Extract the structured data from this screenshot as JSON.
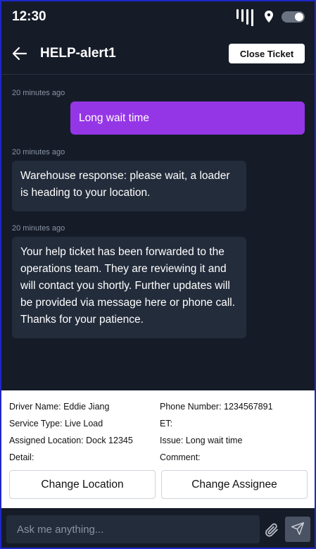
{
  "status_bar": {
    "time": "12:30"
  },
  "header": {
    "title": "HELP-alert1",
    "close_ticket_label": "Close Ticket"
  },
  "messages": [
    {
      "timestamp": "20 minutes ago",
      "direction": "outgoing",
      "text": "Long wait time"
    },
    {
      "timestamp": "20 minutes ago",
      "direction": "incoming",
      "text": "Warehouse response: please wait, a loader is heading to your location."
    },
    {
      "timestamp": "20 minutes ago",
      "direction": "incoming",
      "text": "Your help ticket has been forwarded to the operations team. They are reviewing it and will contact you shortly. Further updates will be provided via message here or phone call. Thanks for your patience."
    }
  ],
  "ticket_info": {
    "driver_name": "Driver Name: Eddie Jiang",
    "phone_number": "Phone Number: 1234567891",
    "service_type": "Service Type: Live Load",
    "et": "ET:",
    "assigned_location": "Assigned Location: Dock 12345",
    "issue": "Issue: Long wait time",
    "detail": "Detail:",
    "comment": "Comment:"
  },
  "actions": {
    "change_location_label": "Change Location",
    "change_assignee_label": "Change Assignee"
  },
  "input": {
    "placeholder": "Ask me anything..."
  },
  "icons": {
    "back": "arrow-left-icon",
    "signal": "signal-icon",
    "location": "location-pin-icon",
    "toggle": "toggle-icon",
    "attach": "paperclip-icon",
    "send": "send-icon"
  },
  "colors": {
    "background": "#151c28",
    "outgoing_bubble": "#9536e6",
    "incoming_bubble": "#232c3b",
    "timestamp": "#8a93a3",
    "frame_border": "#1d27c9"
  }
}
